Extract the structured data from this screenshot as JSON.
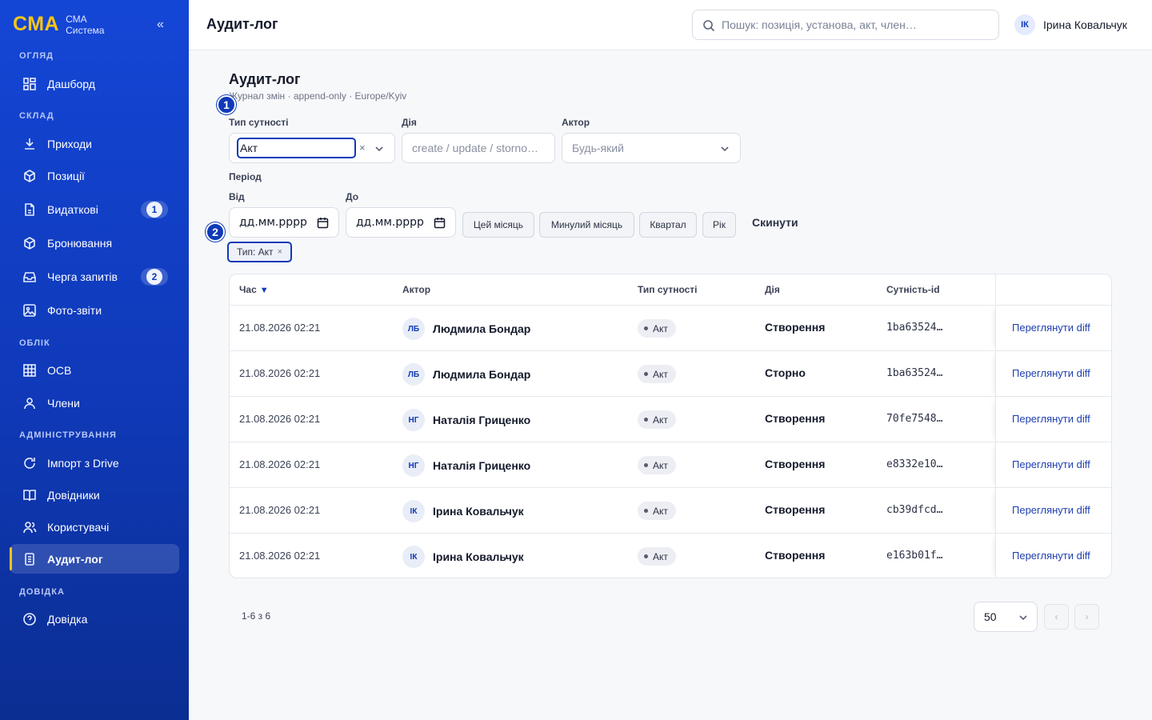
{
  "brand": {
    "logo": "СМА",
    "line1": "СМА",
    "line2": "Система",
    "collapse": "«"
  },
  "sidebar": {
    "sections": {
      "overview": "ОГЛЯД",
      "stock": "СКЛАД",
      "accounting": "ОБЛІК",
      "admin": "АДМІНІСТРУВАННЯ",
      "help": "ДОВІДКА"
    },
    "items": [
      {
        "label": "Дашборд",
        "icon": "dashboard-icon"
      },
      {
        "label": "Приходи",
        "icon": "download-icon"
      },
      {
        "label": "Позиції",
        "icon": "box-icon"
      },
      {
        "label": "Видаткові",
        "icon": "document-icon",
        "badge": "1"
      },
      {
        "label": "Бронювання",
        "icon": "box-icon"
      },
      {
        "label": "Черга запитів",
        "icon": "inbox-icon",
        "badge": "2"
      },
      {
        "label": "Фото-звіти",
        "icon": "image-icon"
      },
      {
        "label": "ОСВ",
        "icon": "grid-icon"
      },
      {
        "label": "Члени",
        "icon": "user-icon"
      },
      {
        "label": "Імпорт з Drive",
        "icon": "refresh-icon"
      },
      {
        "label": "Довідники",
        "icon": "book-icon"
      },
      {
        "label": "Користувачі",
        "icon": "users-icon"
      },
      {
        "label": "Аудит-лог",
        "icon": "clipboard-icon",
        "active": true
      },
      {
        "label": "Довідка",
        "icon": "help-icon"
      }
    ]
  },
  "header": {
    "title": "Аудит-лог",
    "search_placeholder": "Пошук: позиція, установа, акт, член…",
    "user": {
      "initials": "ІК",
      "name": "Ірина Ковальчук"
    }
  },
  "page": {
    "title": "Аудит-лог",
    "subtitle": "Журнал змін · append-only · Europe/Kyiv",
    "steps": [
      "1",
      "2"
    ]
  },
  "filters": {
    "entity_label": "Тип сутності",
    "entity_value": "Акт",
    "clear": "×",
    "action_label": "Дія",
    "action_placeholder": "create / update / storno…",
    "actor_label": "Актор",
    "actor_placeholder": "Будь-який",
    "period_label": "Період",
    "from_label": "Від",
    "to_label": "До",
    "from_value": "дд.мм.рррр",
    "to_value": "дд.мм.рррр",
    "presets": [
      "Цей місяць",
      "Минулий місяць",
      "Квартал",
      "Рік"
    ],
    "reset": "Скинути",
    "active_tag": "Тип: Акт",
    "tag_remove": "×"
  },
  "table": {
    "headers": {
      "time": "Час",
      "sort": "▼",
      "actor": "Актор",
      "entity": "Тип сутності",
      "action": "Дія",
      "id": "Сутність-id"
    },
    "link_label": "Переглянути diff",
    "rows": [
      {
        "time": "21.08.2026 02:21",
        "initials": "ЛБ",
        "actor": "Людмила Бондар",
        "entity": "Акт",
        "action": "Створення",
        "id": "1ba63524…"
      },
      {
        "time": "21.08.2026 02:21",
        "initials": "ЛБ",
        "actor": "Людмила Бондар",
        "entity": "Акт",
        "action": "Сторно",
        "id": "1ba63524…"
      },
      {
        "time": "21.08.2026 02:21",
        "initials": "НГ",
        "actor": "Наталія Гриценко",
        "entity": "Акт",
        "action": "Створення",
        "id": "70fe7548…"
      },
      {
        "time": "21.08.2026 02:21",
        "initials": "НГ",
        "actor": "Наталія Гриценко",
        "entity": "Акт",
        "action": "Створення",
        "id": "e8332e10…"
      },
      {
        "time": "21.08.2026 02:21",
        "initials": "ІК",
        "actor": "Ірина Ковальчук",
        "entity": "Акт",
        "action": "Створення",
        "id": "cb39dfcd…"
      },
      {
        "time": "21.08.2026 02:21",
        "initials": "ІК",
        "actor": "Ірина Ковальчук",
        "entity": "Акт",
        "action": "Створення",
        "id": "e163b01f…"
      }
    ]
  },
  "pagination": {
    "info": "1-6 з 6",
    "page_size": "50",
    "prev": "‹",
    "next": "›"
  },
  "colors": {
    "sidebar": "#1446d6",
    "accent": "#0f39b8",
    "highlight": "#f5c518"
  }
}
